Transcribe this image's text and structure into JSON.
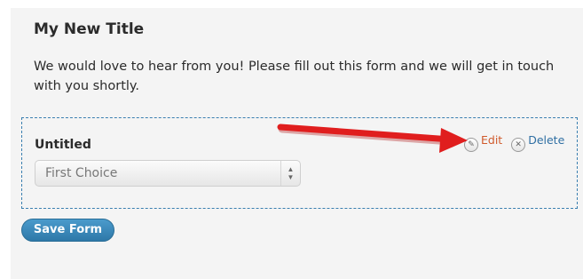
{
  "form": {
    "title": "My New Title",
    "description": "We would love to hear from you! Please fill out this form and we will get in touch with you shortly."
  },
  "field": {
    "label": "Untitled",
    "select_value": "First Choice",
    "edit_label": "Edit",
    "delete_label": "Delete"
  },
  "save_button_label": "Save Form",
  "icons": {
    "edit": "pencil-icon",
    "delete": "x-circle-icon",
    "select": "up-down-arrows-icon",
    "annotation": "red-arrow"
  },
  "colors": {
    "edit_link": "#d05a2c",
    "delete_link": "#2f6fa3",
    "field_border": "#3a7fb0",
    "save_button": "#2e78a8",
    "annotation_arrow": "#e01e1e"
  }
}
